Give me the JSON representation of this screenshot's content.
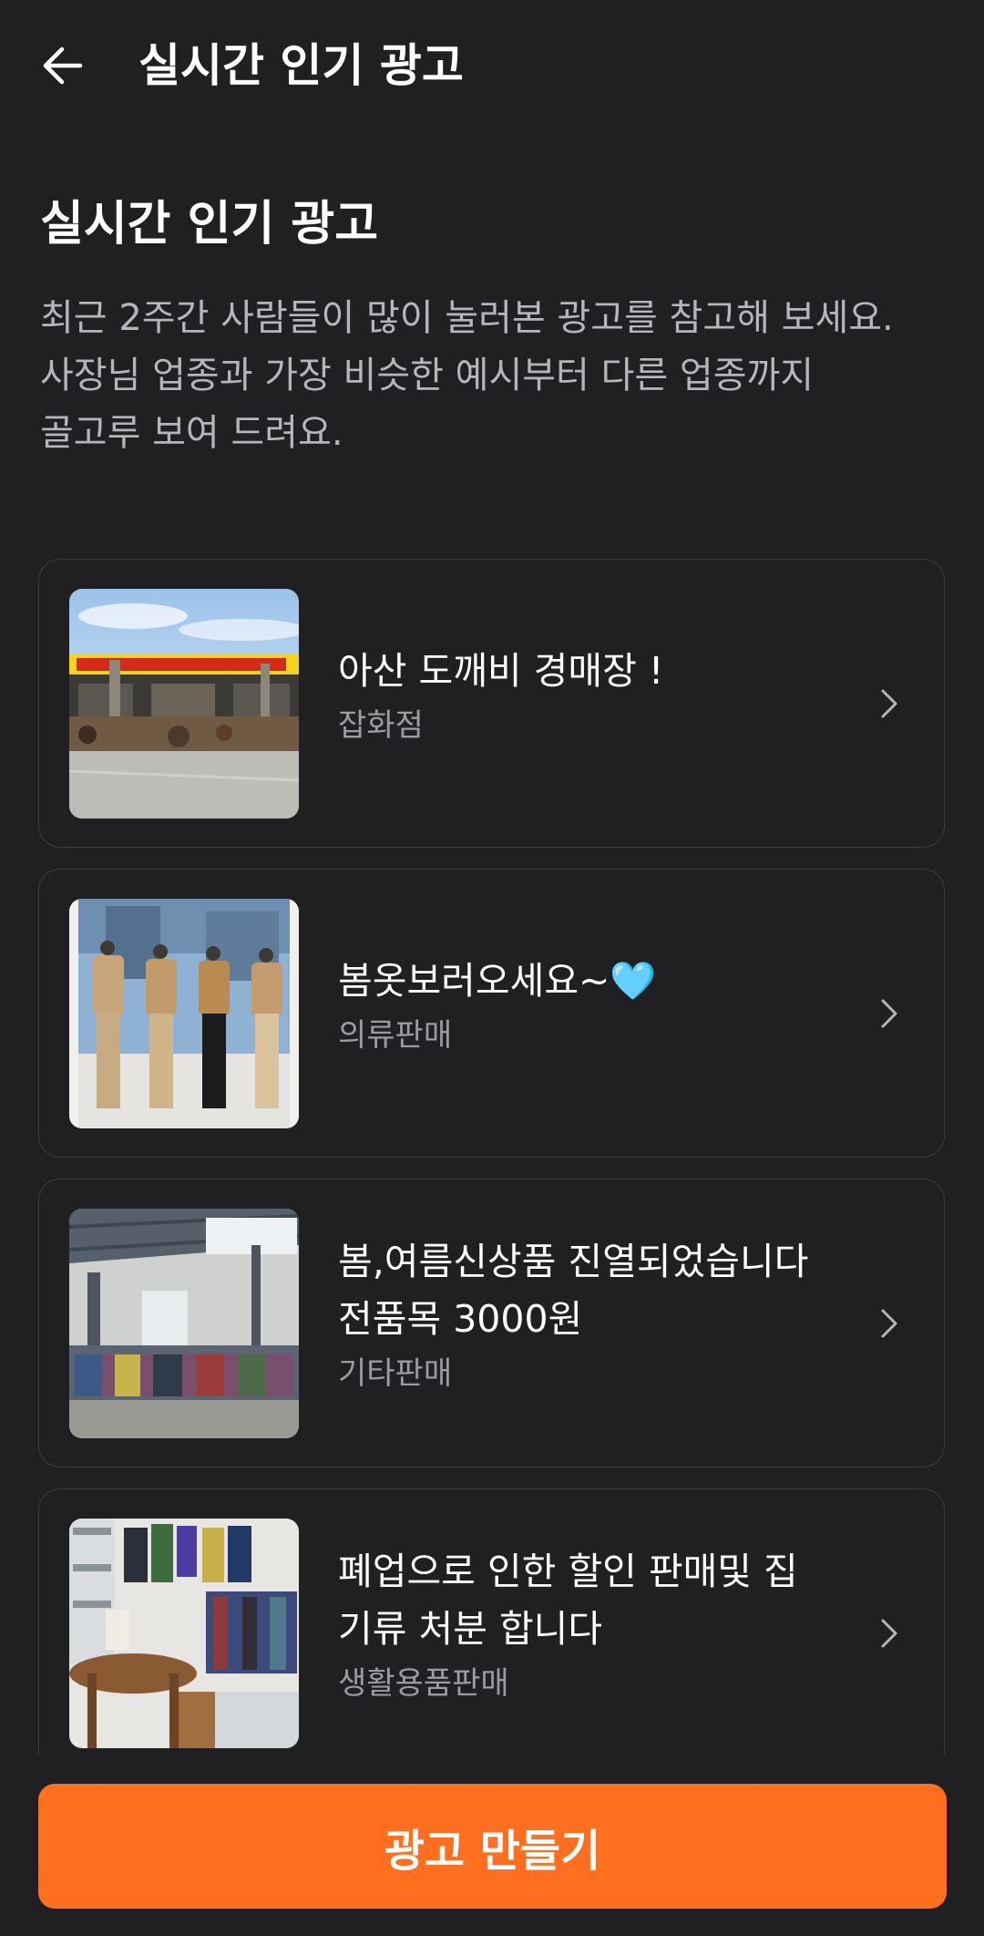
{
  "appbar": {
    "back_icon": "arrow-left-icon",
    "title": "실시간 인기 광고"
  },
  "header": {
    "title": "실시간 인기 광고",
    "description_lines": [
      "최근 2주간 사람들이 많이 눌러본 광고를 참고해 보세요.",
      "사장님 업종과 가장 비슷한 예시부터 다른 업종까지",
      "골고루 보여 드려요."
    ]
  },
  "ads": [
    {
      "title_lines": [
        "아산 도깨비 경매장 !"
      ],
      "category": "잡화점",
      "image": "storefront-photo"
    },
    {
      "title_lines": [
        "봄옷보러오세요~🩵"
      ],
      "category": "의류판매",
      "image": "mannequins-photo"
    },
    {
      "title_lines": [
        "봄,여름신상품 진열되었습니다",
        "전품목 3000원"
      ],
      "category": "기타판매",
      "image": "warehouse-clothes-photo"
    },
    {
      "title_lines": [
        "폐업으로 인한 할인 판매및 집",
        "기류 처분 합니다"
      ],
      "category": "생활용품판매",
      "image": "shop-interior-photo"
    }
  ],
  "cta": {
    "label": "광고 만들기"
  },
  "colors": {
    "background": "#202023",
    "card_border": "#3b3c41",
    "accent": "#ff6f1f",
    "secondary_text": "#9a9ca2"
  }
}
